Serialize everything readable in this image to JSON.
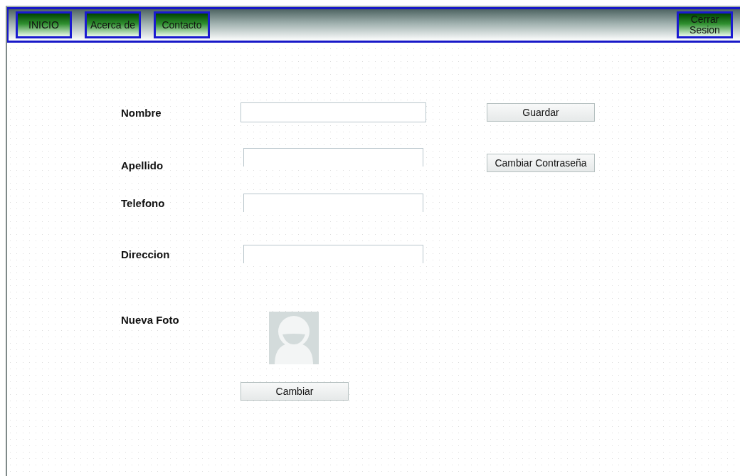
{
  "nav": {
    "links": [
      {
        "label": "INICIO"
      },
      {
        "label": "Acerca de"
      },
      {
        "label": "Contacto"
      }
    ],
    "logout": "Cerrar Sesion"
  },
  "form": {
    "fields": [
      {
        "label": "Nombre",
        "button": "Guardar"
      },
      {
        "label": "Apellido",
        "button": "Cambiar Contraseña"
      },
      {
        "label": "Telefono"
      },
      {
        "label": "Direccion"
      }
    ],
    "photo": {
      "label": "Nueva Foto",
      "button": "Cambiar"
    }
  }
}
